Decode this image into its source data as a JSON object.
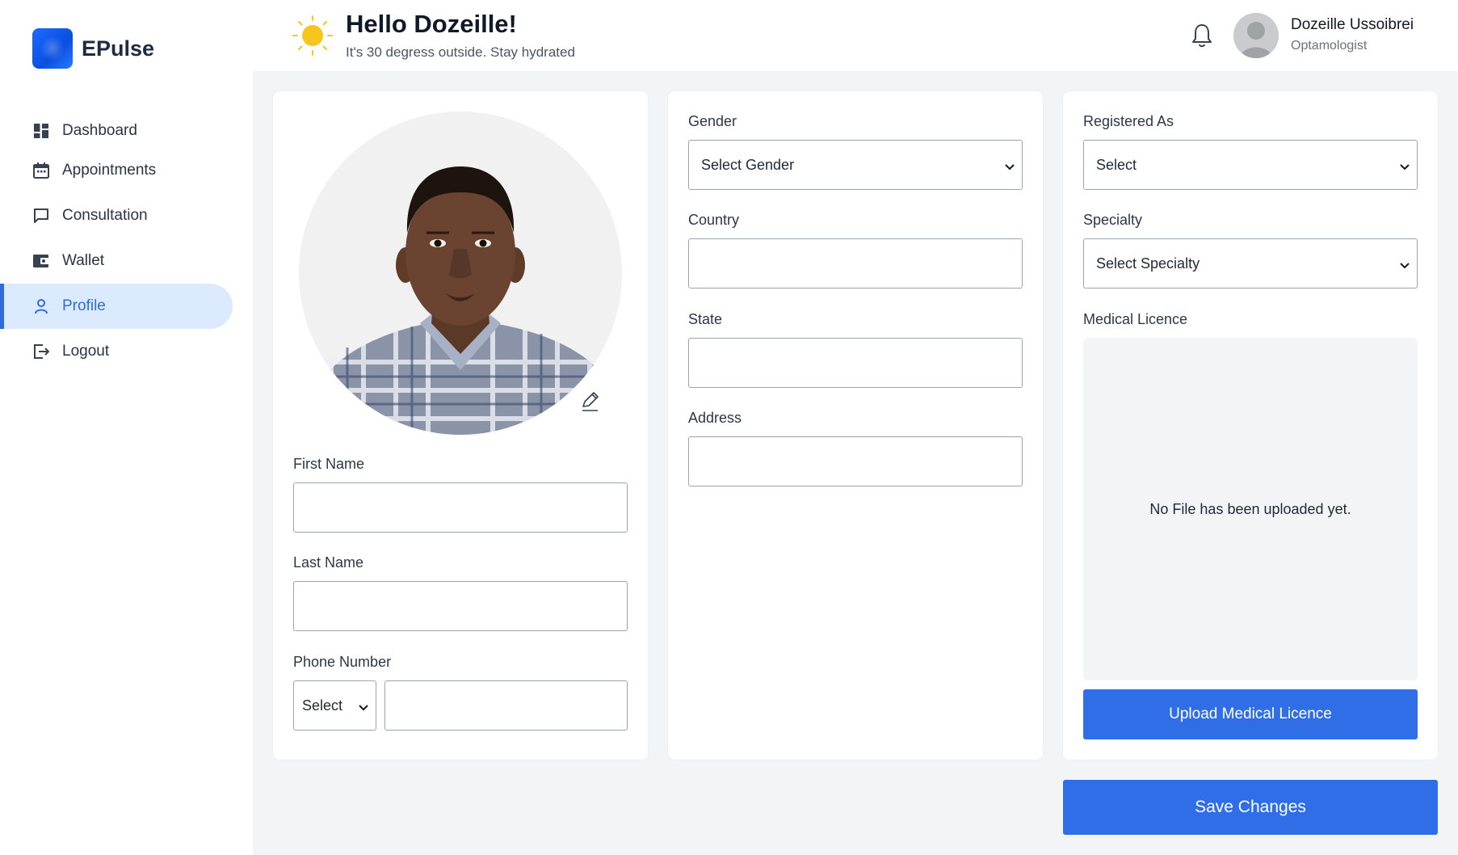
{
  "brand": {
    "name": "EPulse"
  },
  "nav": {
    "items": [
      {
        "label": "Dashboard",
        "icon": "dashboard-icon"
      },
      {
        "label": "Appointments",
        "icon": "calendar-icon"
      },
      {
        "label": "Consultation",
        "icon": "chat-icon"
      },
      {
        "label": "Wallet",
        "icon": "wallet-icon"
      },
      {
        "label": "Profile",
        "icon": "user-icon",
        "active": true
      },
      {
        "label": "Logout",
        "icon": "logout-icon"
      }
    ]
  },
  "header": {
    "title": "Hello Dozeille!",
    "subtitle": "It's 30 degress outside. Stay hydrated",
    "user_name": "Dozeille Ussoibrei",
    "user_role": "Optamologist"
  },
  "form": {
    "first_name": {
      "label": "First Name",
      "value": ""
    },
    "last_name": {
      "label": "Last Name",
      "value": ""
    },
    "phone": {
      "label": "Phone Number",
      "code_select": "Select",
      "value": ""
    },
    "gender": {
      "label": "Gender",
      "selected": "Select Gender"
    },
    "country": {
      "label": "Country",
      "value": ""
    },
    "state": {
      "label": "State",
      "value": ""
    },
    "address": {
      "label": "Address",
      "value": ""
    },
    "registered_as": {
      "label": "Registered As",
      "selected": "Select"
    },
    "specialty": {
      "label": "Specialty",
      "selected": "Select Specialty"
    },
    "licence": {
      "label": "Medical Licence",
      "empty_text": "No File has been uploaded yet.",
      "upload_label": "Upload Medical Licence"
    }
  },
  "actions": {
    "save_label": "Save Changes"
  },
  "colors": {
    "accent": "#2f6ee6",
    "active_bg": "#dbeafe",
    "active_text": "#2f6bdc",
    "page_bg": "#f3f4f6"
  }
}
